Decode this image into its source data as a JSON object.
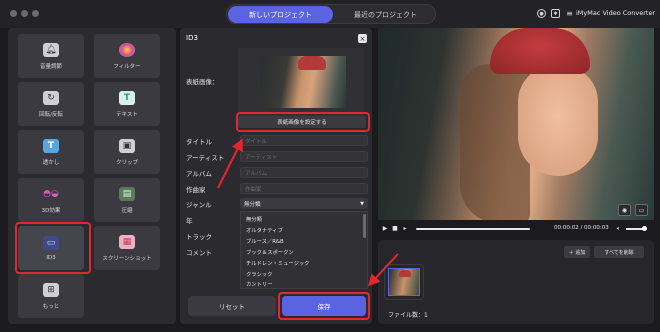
{
  "titlebar": {
    "tabs": [
      {
        "label": "新しいプロジェクト",
        "active": true
      },
      {
        "label": "最近のプロジェクト",
        "active": false
      }
    ],
    "app_name": "iMyMac Video Converter",
    "icons": [
      "user-icon",
      "gear-icon",
      "menu-icon"
    ]
  },
  "tools": [
    {
      "label": "音量調節",
      "icon": "bell-icon"
    },
    {
      "label": "フィルター",
      "icon": "filter-icon"
    },
    {
      "label": "回転/反転",
      "icon": "rotate-icon"
    },
    {
      "label": "テキスト",
      "icon": "text-icon"
    },
    {
      "label": "透かし",
      "icon": "watermark-icon"
    },
    {
      "label": "クリップ",
      "icon": "clip-icon"
    },
    {
      "label": "3D効果",
      "icon": "3d-glasses-icon"
    },
    {
      "label": "圧縮",
      "icon": "compress-icon"
    },
    {
      "label": "ID3",
      "icon": "id3-icon",
      "selected": true
    },
    {
      "label": "スクリーンショット",
      "icon": "screenshot-icon"
    },
    {
      "label": "もっと",
      "icon": "more-icon"
    }
  ],
  "id3": {
    "title": "ID3",
    "cover_label": "表紙画像：",
    "set_cover_button": "表紙画像を設定する",
    "fields": [
      {
        "label": "タイトル",
        "placeholder": "タイトル"
      },
      {
        "label": "アーティスト",
        "placeholder": "アーティスト"
      },
      {
        "label": "アルバム",
        "placeholder": "アルバム"
      },
      {
        "label": "作曲家",
        "placeholder": "作曲家"
      }
    ],
    "genre_label": "ジャンル",
    "genre_value": "無分類",
    "year_label": "年",
    "track_label": "トラック",
    "comment_label": "コメント",
    "genre_options": [
      "無分類",
      "オルタナティブ",
      "ブルース／R&B",
      "ブック＆スポークン",
      "チルドレン・ミュージック",
      "クラシック",
      "カントリー"
    ],
    "reset_button": "リセット",
    "save_button": "保存"
  },
  "player": {
    "time": "00:00:02 / 00:00:03"
  },
  "files": {
    "add_button": "＋ 追加",
    "delete_all_button": "すべてを削除",
    "count_label": "ファイル数：1"
  },
  "colors": {
    "accent": "#5a63e0",
    "highlight": "#e0282e"
  }
}
